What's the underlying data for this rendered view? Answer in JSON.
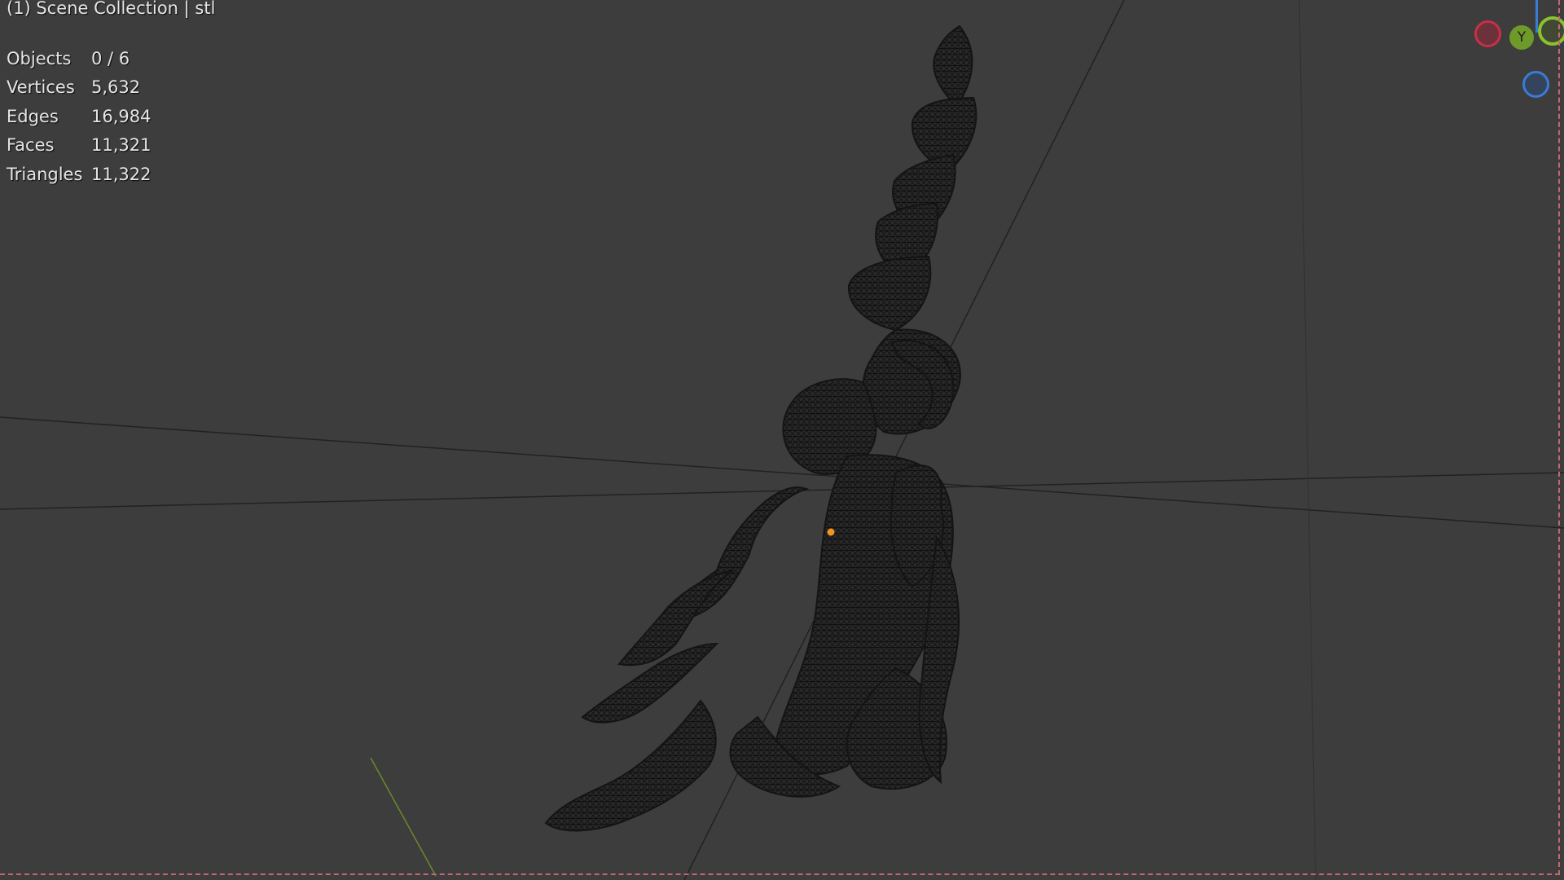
{
  "viewport": {
    "title": "(1) Scene Collection | stl",
    "background": "#3d3d3d"
  },
  "stats": [
    {
      "label": "Objects",
      "value": "0 / 6"
    },
    {
      "label": "Vertices",
      "value": "5,632"
    },
    {
      "label": "Edges",
      "value": "16,984"
    },
    {
      "label": "Faces",
      "value": "11,321"
    },
    {
      "label": "Triangles",
      "value": "11,322"
    }
  ],
  "gizmo": {
    "y_label": "Y",
    "x_color": "#c73045",
    "y_color": "#8ac22e",
    "z_color": "#3a7bd5"
  },
  "icons": [
    "navigation-gizmo",
    "origin-dot-icon"
  ],
  "accent_colors": {
    "origin": "#f0961e",
    "mesh": "#1e1e1e",
    "border": "#c7676c"
  }
}
